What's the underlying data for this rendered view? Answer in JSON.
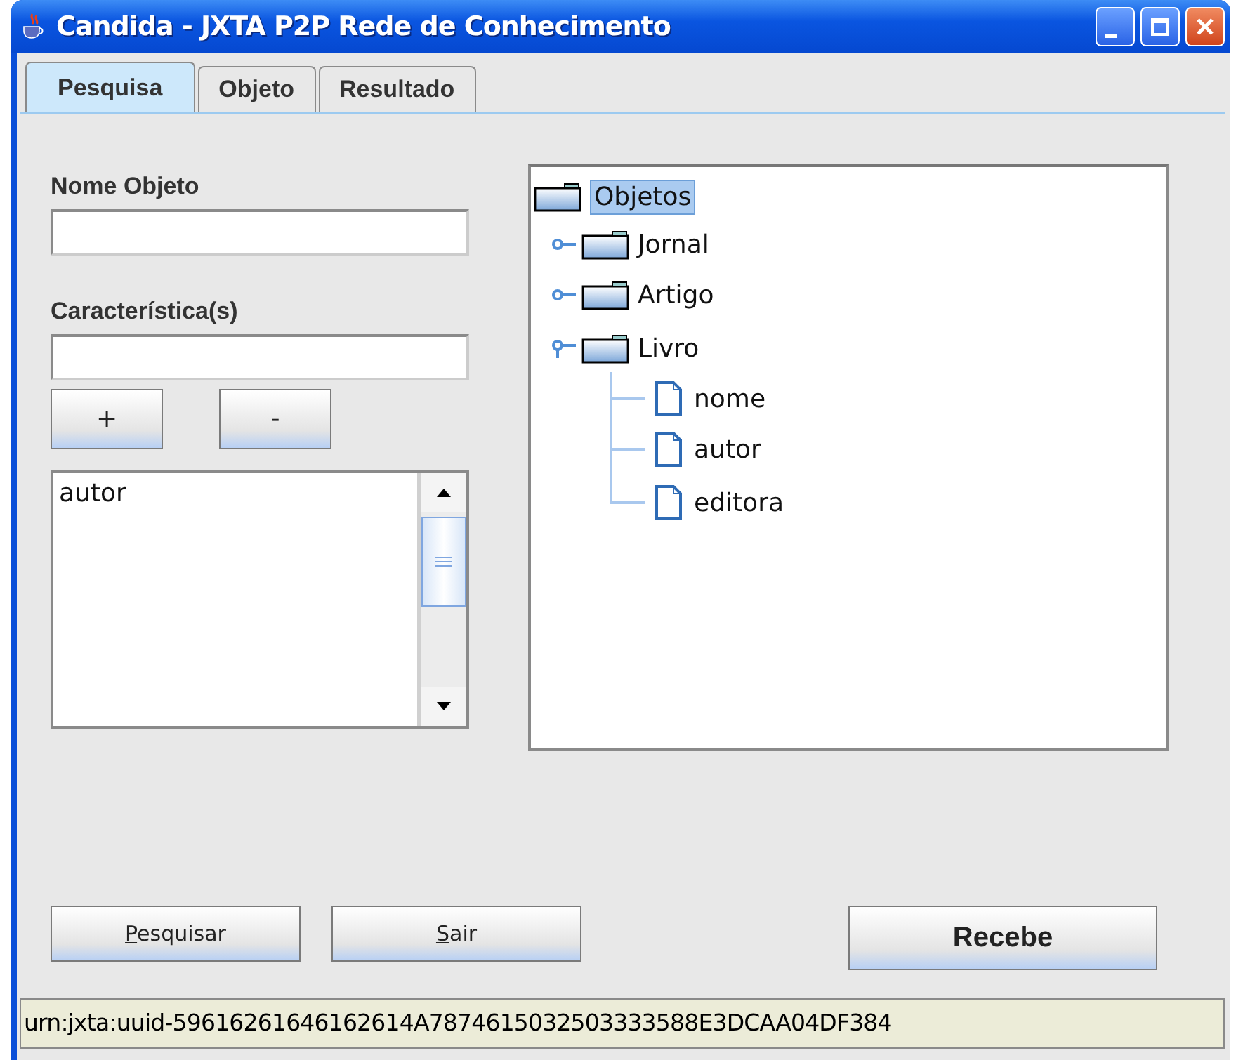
{
  "window": {
    "title": "Candida - JXTA P2P Rede de Conhecimento"
  },
  "tabs": [
    {
      "label": "Pesquisa",
      "selected": true
    },
    {
      "label": "Objeto",
      "selected": false
    },
    {
      "label": "Resultado",
      "selected": false
    }
  ],
  "form": {
    "name_label": "Nome Objeto",
    "features_label": "Característica(s)",
    "add_button": "+",
    "remove_button": "-",
    "features": [
      {
        "text": "autor",
        "selected": false
      }
    ]
  },
  "tree": {
    "label": "Objetos",
    "selected": true,
    "expanded": true,
    "children": [
      {
        "label": "Jornal",
        "kind": "folder",
        "expanded": false
      },
      {
        "label": "Artigo",
        "kind": "folder",
        "expanded": false
      },
      {
        "label": "Livro",
        "kind": "folder",
        "expanded": true,
        "children": [
          {
            "label": "nome",
            "kind": "leaf"
          },
          {
            "label": "autor",
            "kind": "leaf"
          },
          {
            "label": "editora",
            "kind": "leaf"
          }
        ]
      }
    ]
  },
  "buttons": [
    {
      "label": "Pesquisar",
      "mnemonic_underlined": true,
      "default": false
    },
    {
      "label": "Sair",
      "mnemonic_underlined": true,
      "default": false
    },
    {
      "label": "Recebe",
      "mnemonic_underlined": false,
      "default": true
    }
  ],
  "status_bar": "urn:jxta:uuid-59616261646162614A7874615032503333588E3DCAA04DF384"
}
